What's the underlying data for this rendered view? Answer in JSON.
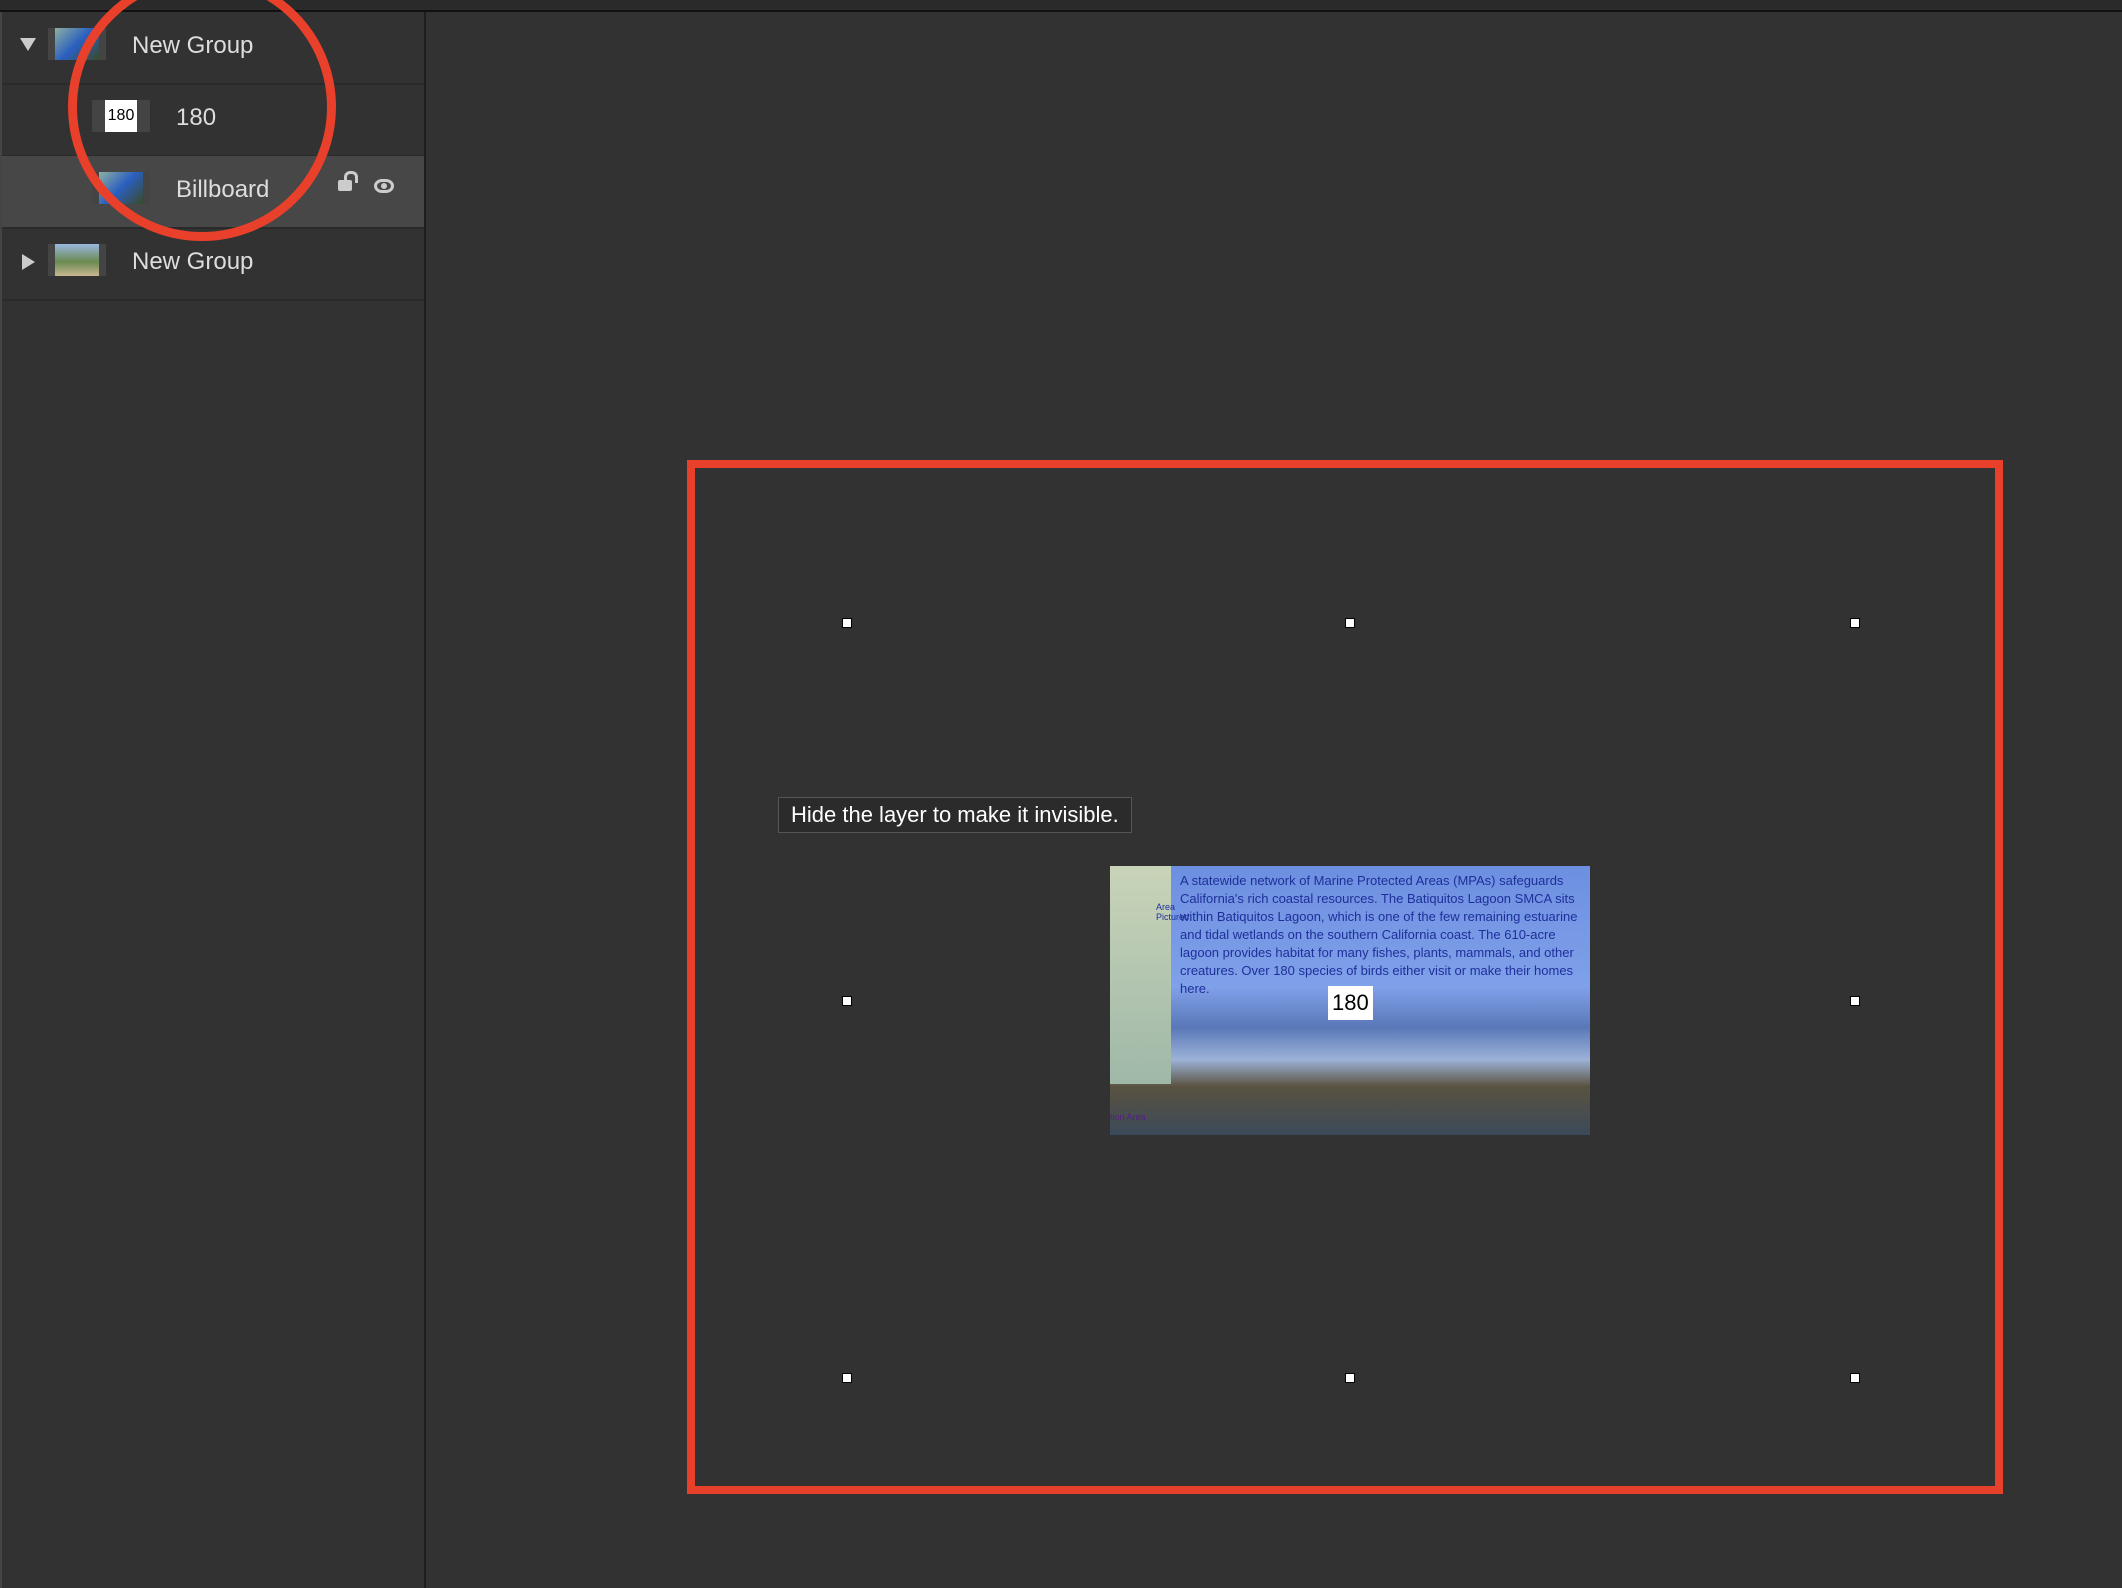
{
  "layers": [
    {
      "name": "New Group",
      "expanded": true,
      "level": 0,
      "thumb": "billboard-thumb"
    },
    {
      "name": "180",
      "level": 1,
      "thumb_text": "180"
    },
    {
      "name": "Billboard",
      "level": 1,
      "selected": true,
      "thumb": "billboard-thumb"
    },
    {
      "name": "New Group",
      "expanded": false,
      "level": 0,
      "thumb": "path-thumb"
    }
  ],
  "tooltip": "Hide the layer to make it invisible.",
  "canvas": {
    "billboard_text": "A statewide network of Marine Protected Areas (MPAs) safeguards California's rich coastal resources. The Batiquitos Lagoon SMCA sits within Batiquitos Lagoon, which is one of the few remaining estuarine and tidal wetlands on the southern California coast. The 610-acre lagoon provides habitat for many fishes, plants, mammals, and other creatures. Over 180 species of birds either visit or make their homes here.",
    "map_label": "Area Pictured",
    "map_footer": "tion Area",
    "text_layer": "180"
  },
  "colors": {
    "annotation": "#e8402a",
    "selected_row": "#474747"
  }
}
